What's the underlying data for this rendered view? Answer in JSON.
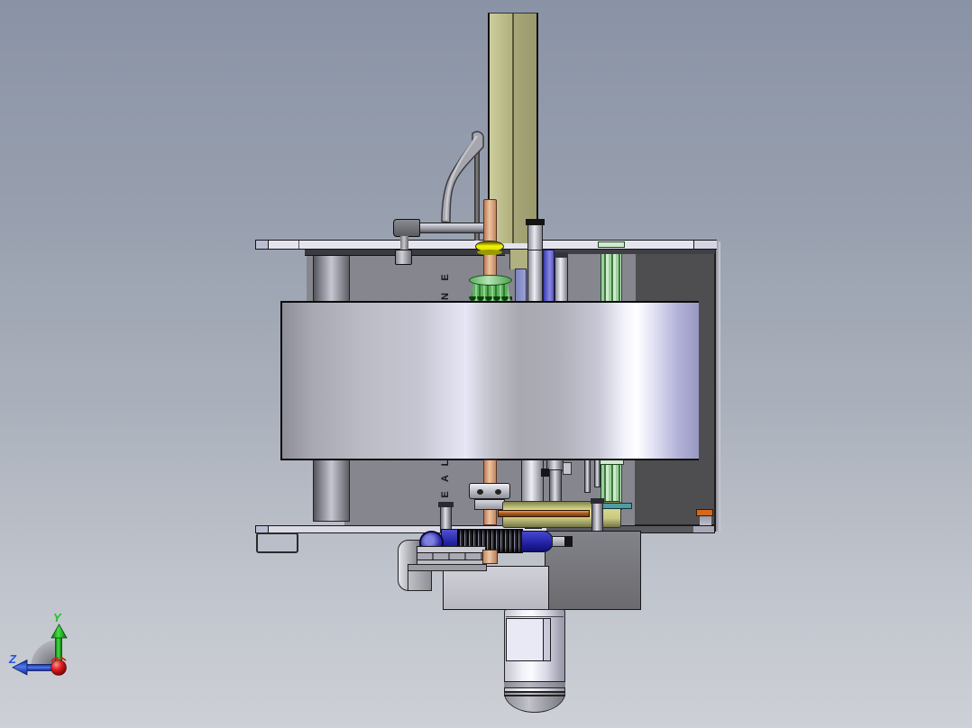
{
  "scene": {
    "background": {
      "top": "#8a93a6",
      "bottom": "#cdd0d6"
    }
  },
  "triad": {
    "y_label": "Y",
    "z_label": "Z",
    "y_color": "#1eb41e",
    "z_color": "#2255dd",
    "origin_color": "#cc1111",
    "arc_color": "#8d8d95"
  },
  "machine": {
    "panel_text_upper": [
      "E",
      "N"
    ],
    "panel_text_lower": [
      "L",
      "A",
      "E"
    ],
    "colors": {
      "frame_plate": "#e4e4ef",
      "back_panel_gray": "#86868f",
      "side_panel_dark": "#4e4e50",
      "column_olive": "#b5b583",
      "support_cylinder": "#c6c6d0",
      "drum_silver": "#d9d9e4",
      "copper_shaft": "#d9a77f",
      "washer_yellow": "#e8e800",
      "bevel_gear_green": "#55b055",
      "guide_rail_green": "#b7dcb7",
      "shaft_blue_violet": "#6868cc",
      "worm_gear_blue": "#2828b4",
      "gear_disc_yellow": "#c6c67e",
      "bar_brown": "#a4561c",
      "clip_orange": "#d2691e",
      "strip_teal": "#4f9d9d",
      "housing_light": "#c3c3cb",
      "housing_dark": "#717174",
      "motor_body": "#eeeef6"
    }
  }
}
